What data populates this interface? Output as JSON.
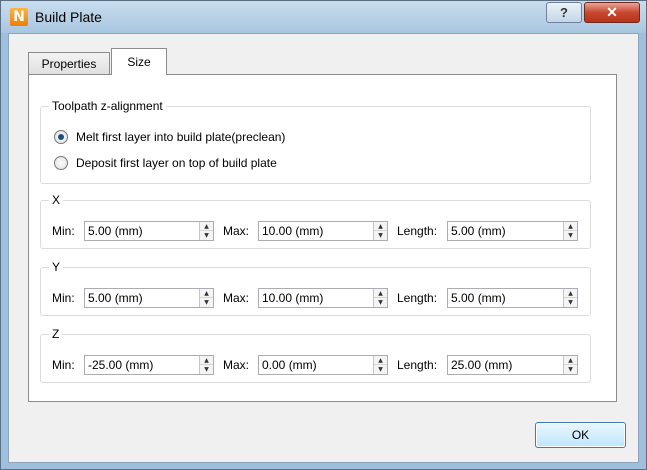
{
  "window": {
    "title": "Build Plate",
    "app_icon_letter": "N",
    "help_label": "?",
    "close_label": "✕"
  },
  "tabs": [
    {
      "label": "Properties",
      "active": false
    },
    {
      "label": "Size",
      "active": true
    }
  ],
  "alignment": {
    "legend": "Toolpath z-alignment",
    "options": [
      {
        "label": "Melt first layer into build plate(preclean)",
        "checked": true
      },
      {
        "label": "Deposit first layer on top of build plate",
        "checked": false
      }
    ]
  },
  "axes": [
    {
      "legend": "X",
      "min_label": "Min:",
      "min": "5.00 (mm)",
      "max_label": "Max:",
      "max": "10.00 (mm)",
      "length_label": "Length:",
      "length": "5.00 (mm)"
    },
    {
      "legend": "Y",
      "min_label": "Min:",
      "min": "5.00 (mm)",
      "max_label": "Max:",
      "max": "10.00 (mm)",
      "length_label": "Length:",
      "length": "5.00 (mm)"
    },
    {
      "legend": "Z",
      "min_label": "Min:",
      "min": "-25.00 (mm)",
      "max_label": "Max:",
      "max": "0.00 (mm)",
      "length_label": "Length:",
      "length": "25.00 (mm)"
    }
  ],
  "spin_icons": {
    "up": "▲",
    "down": "▼"
  },
  "footer": {
    "ok_label": "OK"
  }
}
